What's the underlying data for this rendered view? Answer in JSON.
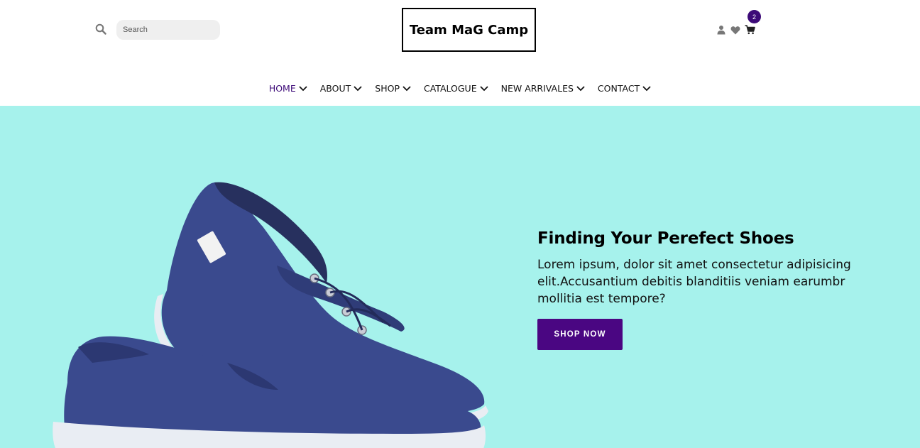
{
  "header": {
    "search": {
      "placeholder": "Search",
      "value": ""
    },
    "logo_text": "Team MaG Camp",
    "icons": [
      "search-icon",
      "user-icon",
      "heart-icon",
      "cart-icon"
    ],
    "cart_count": "2"
  },
  "nav": {
    "items": [
      {
        "label": "HOME",
        "active": true
      },
      {
        "label": "ABOUT",
        "active": false
      },
      {
        "label": "SHOP",
        "active": false
      },
      {
        "label": "CATALOGUE",
        "active": false
      },
      {
        "label": "NEW ARRIVALES",
        "active": false
      },
      {
        "label": "CONTACT",
        "active": false
      }
    ]
  },
  "hero": {
    "title": "Finding Your Perefect Shoes",
    "description": "Lorem ipsum, dolor sit amet consectetur adipisicing elit.Accusantium debitis blanditiis veniam earumbr mollitia est tempore?",
    "button_label": "SHOP NOW"
  },
  "colors": {
    "accent": "#3d0a78",
    "button": "#4a0682",
    "hero_background": "#a6f2ec",
    "shoe": "#3a4a8e"
  }
}
